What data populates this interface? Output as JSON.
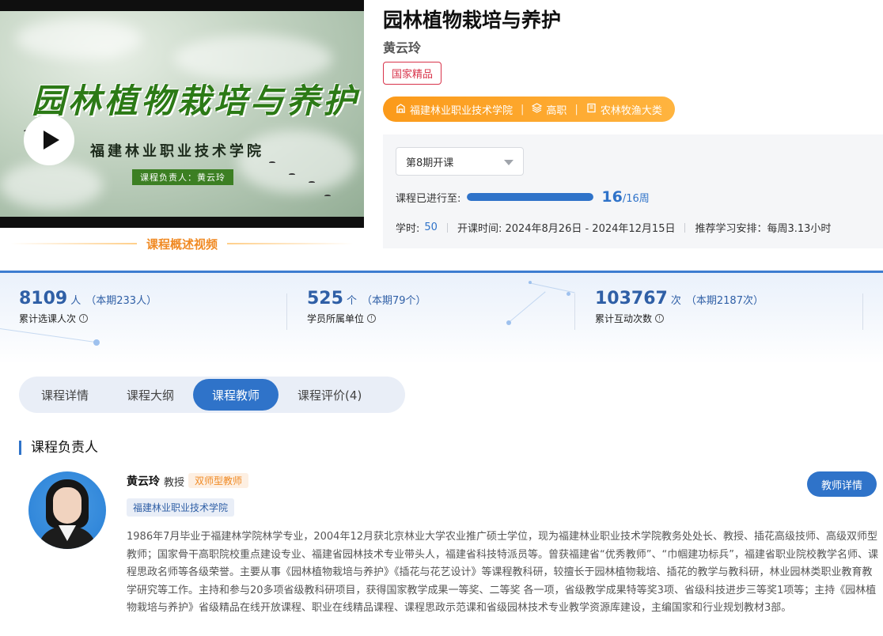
{
  "video": {
    "title_art": "园林植物栽培与养护",
    "school": "福建林业职业技术学院",
    "lead": "课程负责人：黄云玲",
    "caption": "课程概述视频"
  },
  "course": {
    "title": "园林植物栽培与养护",
    "teacher": "黄云玲",
    "badge": "国家精品",
    "tags": [
      "福建林业职业技术学院",
      "高职",
      "农林牧渔大类"
    ],
    "tag_icons": [
      "building-icon",
      "layers-icon",
      "book-icon"
    ]
  },
  "term": {
    "selected": "第8期开课",
    "progress_label": "课程已进行至:",
    "current_week": "16",
    "total_weeks": "/16周",
    "progress_fraction": 1.0,
    "hours_label": "学时:",
    "hours": "50",
    "dates": "开课时间: 2024年8月26日 - 2024年12月15日",
    "schedule": "推荐学习安排：每周3.13小时"
  },
  "stats": [
    {
      "num": "8109",
      "unit": "人",
      "period": "（本期233人）",
      "label": "累计选课人次"
    },
    {
      "num": "525",
      "unit": "个",
      "period": "（本期79个）",
      "label": "学员所属单位"
    },
    {
      "num": "103767",
      "unit": "次",
      "period": "（本期2187次）",
      "label": "累计互动次数"
    }
  ],
  "tabs": [
    "课程详情",
    "课程大纲",
    "课程教师",
    "课程评价(4)"
  ],
  "active_tab": 2,
  "section": {
    "title": "课程负责人"
  },
  "teacher": {
    "name": "黄云玲",
    "rank": "教授",
    "type": "双师型教师",
    "school": "福建林业职业技术学院",
    "detail_button": "教师详情",
    "bio": "1986年7月毕业于福建林学院林学专业，2004年12月获北京林业大学农业推广硕士学位，现为福建林业职业技术学院教务处处长、教授、插花高级技师、高级双师型教师；国家骨干高职院校重点建设专业、福建省园林技术专业带头人，福建省科技特派员等。曾获福建省“优秀教师”、“巾帼建功标兵”，福建省职业院校教学名师、课程思政名师等各级荣誉。主要从事《园林植物栽培与养护》《插花与花艺设计》等课程教科研，较擅长于园林植物栽培、插花的教学与教科研，林业园林类职业教育教学研究等工作。主持和参与20多项省级教科研项目，获得国家教学成果一等奖、二等奖 各一项，省级教学成果特等奖3项、省级科技进步三等奖1项等；主持《园林植物栽培与养护》省级精品在线开放课程、职业在线精品课程、课程思政示范课和省级园林技术专业教学资源库建设，主编国家和行业规划教材3部。"
  }
}
